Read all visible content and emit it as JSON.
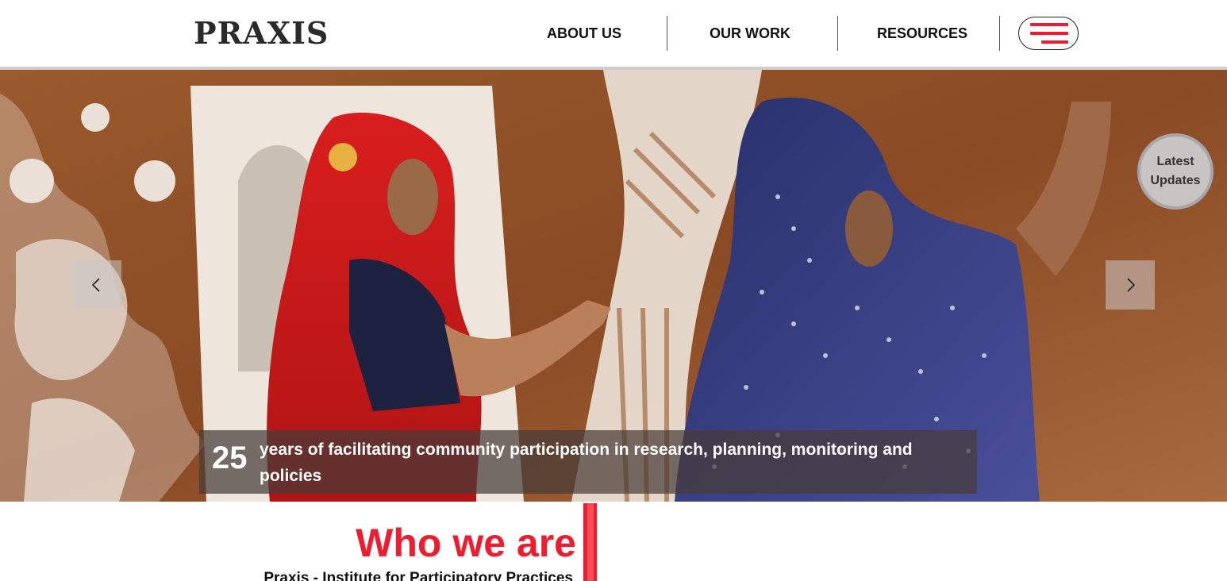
{
  "header": {
    "logo": "PRAXIS",
    "nav": [
      {
        "label": "ABOUT US"
      },
      {
        "label": "OUR WORK"
      },
      {
        "label": "RESOURCES"
      }
    ],
    "menu_icon": "hamburger-icon",
    "accent_color": "#ee1c2e"
  },
  "hero": {
    "prev_icon": "chevron-left-icon",
    "next_icon": "chevron-right-icon",
    "updates_label_line1": "Latest",
    "updates_label_line2": "Updates",
    "caption_number": "25",
    "caption_text": "years of facilitating community participation in research, planning, monitoring and policies"
  },
  "who": {
    "title": "Who we are",
    "subtitle": "Praxis - Institute for Participatory Practices"
  }
}
